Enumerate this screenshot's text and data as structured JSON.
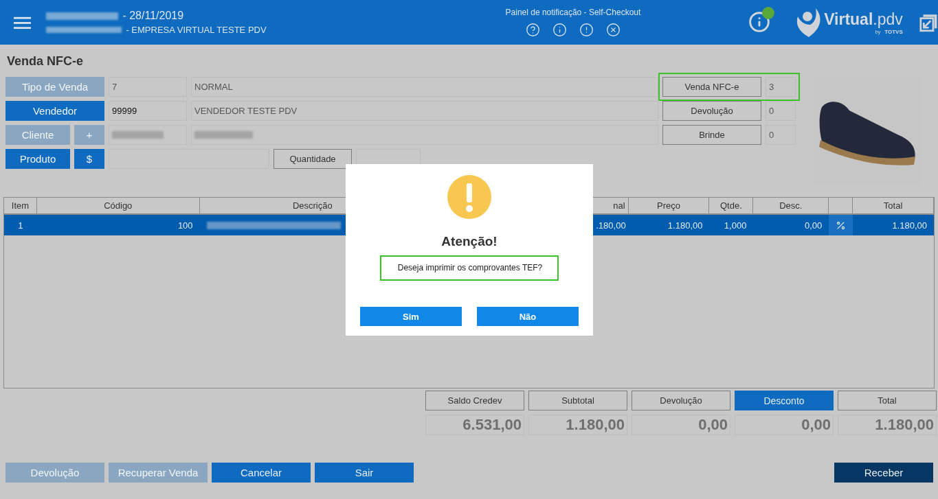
{
  "header": {
    "date_line": "- 28/11/2019",
    "company_line": "- EMPRESA VIRTUAL TESTE PDV",
    "notification_title": "Painel de notificação - Self-Checkout",
    "status_online": true,
    "logo": {
      "wordmark": "Virtual",
      "suffix": ".pdv",
      "by": "by",
      "brand": "TOTVS"
    }
  },
  "page_title": "Venda NFC-e",
  "form_rows": [
    {
      "kind": "record",
      "buttons": [
        {
          "label": "Tipo de Venda",
          "disabled": true
        }
      ],
      "code": "7",
      "description": "NORMAL",
      "blurred": false
    },
    {
      "kind": "record",
      "buttons": [
        {
          "label": "Vendedor",
          "disabled": false
        }
      ],
      "code": "99999",
      "description": "VENDEDOR TESTE PDV",
      "blurred": false
    },
    {
      "kind": "record",
      "buttons": [
        {
          "label": "Cliente",
          "disabled": true
        },
        {
          "label": "+",
          "disabled": true
        }
      ],
      "blurred": true
    },
    {
      "kind": "product",
      "buttons": [
        {
          "label": "Produto",
          "disabled": false
        },
        {
          "label": "$",
          "disabled": false
        }
      ],
      "quantity_label": "Quantidade"
    }
  ],
  "counters": [
    {
      "label": "Venda NFC-e",
      "value": "3",
      "highlighted": true
    },
    {
      "label": "Devolução",
      "value": "0",
      "highlighted": false
    },
    {
      "label": "Brinde",
      "value": "0",
      "highlighted": false
    }
  ],
  "table": {
    "columns": [
      "Item",
      "Código",
      "Descrição",
      "nal",
      "Preço",
      "Qtde.",
      "Desc.",
      "Total"
    ],
    "rows": [
      {
        "selected": true,
        "item": "1",
        "code": "100",
        "description_blurred": true,
        "column_4": ".180,00",
        "price": "1.180,00",
        "qty": "1,000",
        "discount": "0,00",
        "total": "1.180,00"
      }
    ]
  },
  "totals": [
    {
      "label": "Saldo Credev",
      "value": "6.531,00",
      "highlighted": false
    },
    {
      "label": "Subtotal",
      "value": "1.180,00",
      "highlighted": false
    },
    {
      "label": "Devolução",
      "value": "0,00",
      "highlighted": false
    },
    {
      "label": "Desconto",
      "value": "0,00",
      "highlighted": true
    },
    {
      "label": "Total",
      "value": "1.180,00",
      "highlighted": false
    }
  ],
  "footer_buttons": [
    {
      "label": "Devolução",
      "disabled": true,
      "kind": "normal"
    },
    {
      "label": "Recuperar Venda",
      "disabled": true,
      "kind": "normal"
    },
    {
      "label": "Cancelar",
      "disabled": false,
      "kind": "normal"
    },
    {
      "label": "Sair",
      "disabled": false,
      "kind": "normal"
    },
    {
      "label": "Receber",
      "disabled": false,
      "kind": "primary"
    }
  ],
  "dialog": {
    "title": "Atenção!",
    "message": "Deseja imprimir os comprovantes TEF?",
    "message_highlighted": true,
    "buttons": [
      "Sim",
      "Não"
    ]
  }
}
